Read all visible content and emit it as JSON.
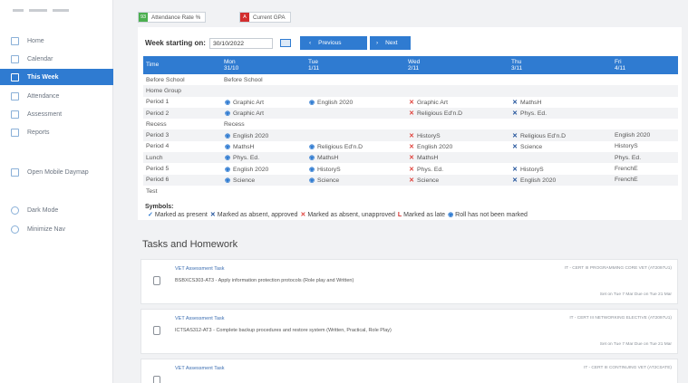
{
  "chips": [
    {
      "badge": "93",
      "badge_color": "#4caf50",
      "label": "Attendance Rate %"
    },
    {
      "badge": "A",
      "badge_color": "#d32f2f",
      "label": "Current GPA"
    }
  ],
  "sidebar": {
    "items": [
      {
        "label": "Home",
        "icon": "home-icon"
      },
      {
        "label": "Calendar",
        "icon": "calendar-icon"
      },
      {
        "label": "This Week",
        "icon": "week-icon",
        "active": true
      },
      {
        "label": "Attendance",
        "icon": "attendance-icon"
      },
      {
        "label": "Assessment",
        "icon": "assessment-icon"
      },
      {
        "label": "Reports",
        "icon": "reports-icon"
      },
      {
        "label": "Open Mobile Daymap",
        "icon": "mobile-icon"
      },
      {
        "label": "Dark Mode",
        "icon": "dark-mode-icon"
      },
      {
        "label": "Minimize Nav",
        "icon": "minimize-icon"
      }
    ]
  },
  "timetable": {
    "week_label": "Week starting on:",
    "week_value": "30/10/2022",
    "prev_label": "Previous",
    "next_label": "Next",
    "headers": [
      {
        "day": "Time",
        "date": ""
      },
      {
        "day": "Mon",
        "date": "31/10"
      },
      {
        "day": "Tue",
        "date": "1/11"
      },
      {
        "day": "Wed",
        "date": "2/11"
      },
      {
        "day": "Thu",
        "date": "3/11"
      },
      {
        "day": "Fri",
        "date": "4/11"
      }
    ],
    "rows": [
      {
        "time": "Before School",
        "cells": [
          {
            "m": "",
            "t": "Before School"
          },
          {
            "m": "",
            "t": ""
          },
          {
            "m": "",
            "t": ""
          },
          {
            "m": "",
            "t": ""
          },
          {
            "m": "",
            "t": ""
          }
        ]
      },
      {
        "time": "Home Group",
        "cells": [
          {
            "m": "",
            "t": ""
          },
          {
            "m": "",
            "t": ""
          },
          {
            "m": "",
            "t": ""
          },
          {
            "m": "",
            "t": ""
          },
          {
            "m": "",
            "t": ""
          }
        ]
      },
      {
        "time": "Period 1",
        "cells": [
          {
            "m": "roll",
            "t": "Graphic Art"
          },
          {
            "m": "roll",
            "t": "English 2020"
          },
          {
            "m": "ua",
            "t": "Graphic Art"
          },
          {
            "m": "ap",
            "t": "MathsH"
          },
          {
            "m": "",
            "t": ""
          }
        ]
      },
      {
        "time": "Period 2",
        "cells": [
          {
            "m": "roll",
            "t": "Graphic Art"
          },
          {
            "m": "",
            "t": ""
          },
          {
            "m": "ua",
            "t": "Religious Ed'n.D"
          },
          {
            "m": "ap",
            "t": "Phys. Ed."
          },
          {
            "m": "",
            "t": ""
          }
        ]
      },
      {
        "time": "Recess",
        "cells": [
          {
            "m": "",
            "t": "Recess"
          },
          {
            "m": "",
            "t": ""
          },
          {
            "m": "",
            "t": ""
          },
          {
            "m": "",
            "t": ""
          },
          {
            "m": "",
            "t": ""
          }
        ]
      },
      {
        "time": "Period 3",
        "cells": [
          {
            "m": "roll",
            "t": "English 2020"
          },
          {
            "m": "",
            "t": ""
          },
          {
            "m": "ua",
            "t": "HistoryS"
          },
          {
            "m": "ap",
            "t": "Religious Ed'n.D"
          },
          {
            "m": "",
            "t": "English 2020"
          }
        ]
      },
      {
        "time": "Period 4",
        "cells": [
          {
            "m": "roll",
            "t": "MathsH"
          },
          {
            "m": "roll",
            "t": "Religious Ed'n.D"
          },
          {
            "m": "ua",
            "t": "English 2020"
          },
          {
            "m": "ap",
            "t": "Science"
          },
          {
            "m": "",
            "t": "HistoryS"
          }
        ]
      },
      {
        "time": "Lunch",
        "cells": [
          {
            "m": "roll",
            "t": "Phys. Ed."
          },
          {
            "m": "roll",
            "t": "MathsH"
          },
          {
            "m": "ua",
            "t": "MathsH"
          },
          {
            "m": "",
            "t": ""
          },
          {
            "m": "",
            "t": "Phys. Ed."
          }
        ]
      },
      {
        "time": "Period 5",
        "cells": [
          {
            "m": "roll",
            "t": "English 2020"
          },
          {
            "m": "roll",
            "t": "HistoryS"
          },
          {
            "m": "ua",
            "t": "Phys. Ed."
          },
          {
            "m": "ap",
            "t": "HistoryS"
          },
          {
            "m": "",
            "t": "FrenchE"
          }
        ]
      },
      {
        "time": "Period 6",
        "cells": [
          {
            "m": "roll",
            "t": "Science"
          },
          {
            "m": "roll",
            "t": "Science"
          },
          {
            "m": "ua",
            "t": "Science"
          },
          {
            "m": "ap",
            "t": "English 2020"
          },
          {
            "m": "",
            "t": "FrenchE"
          }
        ]
      },
      {
        "time": "Test",
        "cells": [
          {
            "m": "",
            "t": ""
          },
          {
            "m": "",
            "t": ""
          },
          {
            "m": "",
            "t": ""
          },
          {
            "m": "",
            "t": ""
          },
          {
            "m": "",
            "t": ""
          }
        ]
      }
    ]
  },
  "marks": {
    "roll": "◉",
    "ua": "✕",
    "ap": "✕"
  },
  "symbols": {
    "heading": "Symbols:",
    "items": [
      {
        "mark": "✓",
        "color": "#2f7bd1",
        "label": "Marked as present"
      },
      {
        "mark": "✕",
        "color": "#1d4f99",
        "label": "Marked as absent, approved"
      },
      {
        "mark": "✕",
        "color": "#e0403a",
        "label": "Marked as absent, unapproved"
      },
      {
        "mark": "L",
        "color": "#d32f2f",
        "label": "Marked as late"
      },
      {
        "mark": "◉",
        "color": "#2f7bd1",
        "label": "Roll has not been marked"
      }
    ]
  },
  "tasks": {
    "heading": "Tasks and Homework",
    "items": [
      {
        "title": "VET Assessment Task",
        "code": "IT - CERT III PROGRAMMING CORE VET (AT2097U1)",
        "desc": "BSBXCS303-AT3 - Apply information protection protocols (Role play and Written)",
        "dates": "Set on Tue 7 Mar    Due on Tue 21 Mar"
      },
      {
        "title": "VET Assessment Task",
        "code": "IT - CERT III NETWORKING ELECTIVE (AT2097U1)",
        "desc": "ICTSAS312-AT3 - Complete backup procedures and restore system (Written, Practical, Role Play)",
        "dates": "Set on Tue 7 Mar    Due on Tue 21 Mar"
      },
      {
        "title": "VET Assessment Task",
        "code": "IT - CERT III CONTINUING VET (AT2C0ATE)",
        "desc": "",
        "dates": ""
      }
    ]
  }
}
